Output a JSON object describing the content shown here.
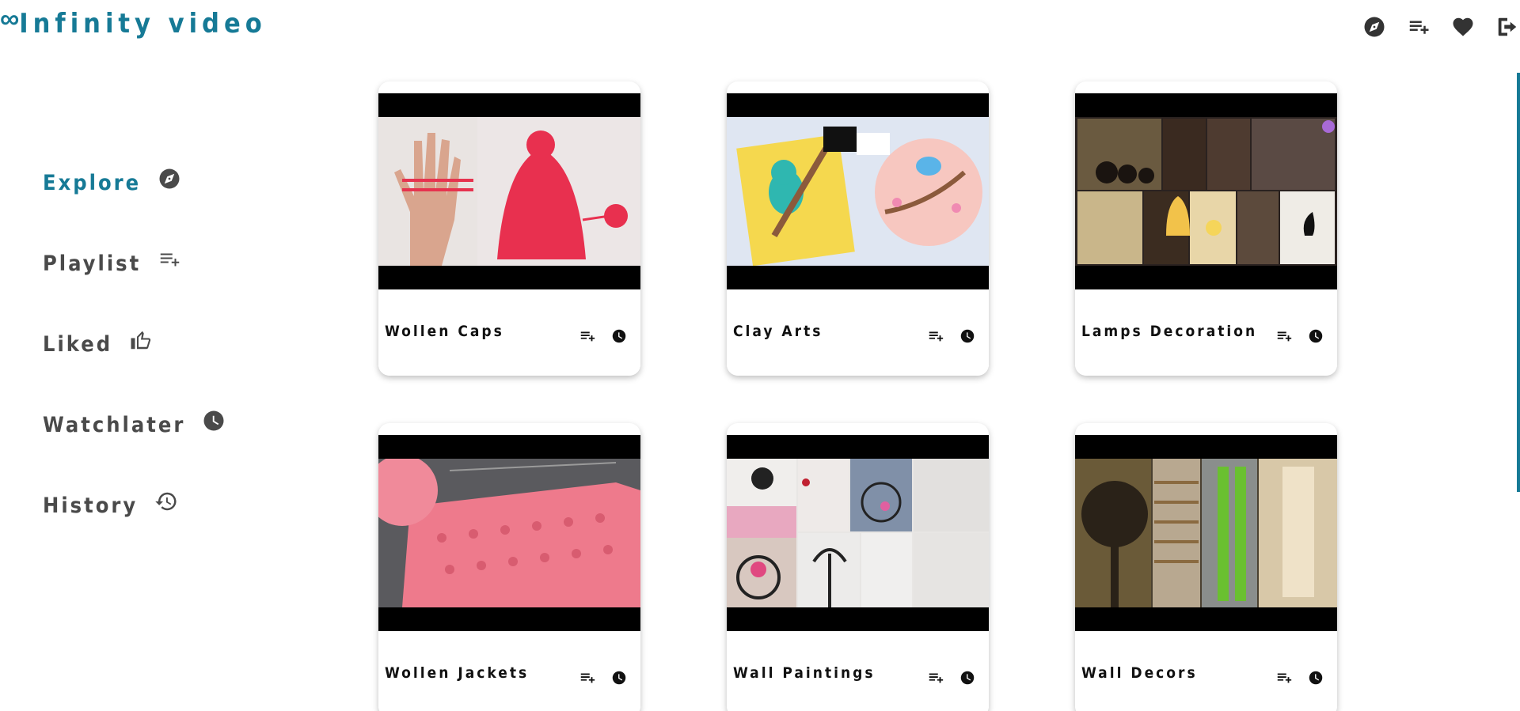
{
  "app": {
    "logo_glyph": "∞",
    "title": "Infinity video"
  },
  "header": {
    "icons": [
      "explore-icon",
      "playlist-add-icon",
      "heart-icon",
      "logout-icon"
    ]
  },
  "sidebar": {
    "items": [
      {
        "label": "Explore",
        "icon": "explore-icon",
        "active": true
      },
      {
        "label": "Playlist",
        "icon": "playlist-add-icon",
        "active": false
      },
      {
        "label": "Liked",
        "icon": "thumbs-up-icon",
        "active": false
      },
      {
        "label": "Watchlater",
        "icon": "clock-icon",
        "active": false
      },
      {
        "label": "History",
        "icon": "history-icon",
        "active": false
      }
    ]
  },
  "videos": [
    {
      "title": "Wollen Caps"
    },
    {
      "title": "Clay Arts"
    },
    {
      "title": "Lamps Decoration"
    },
    {
      "title": "Wollen Jackets"
    },
    {
      "title": "Wall Paintings"
    },
    {
      "title": "Wall Decors"
    }
  ],
  "colors": {
    "accent": "#167a96",
    "text": "#4a4a4a",
    "thumb_border": "#000000"
  }
}
